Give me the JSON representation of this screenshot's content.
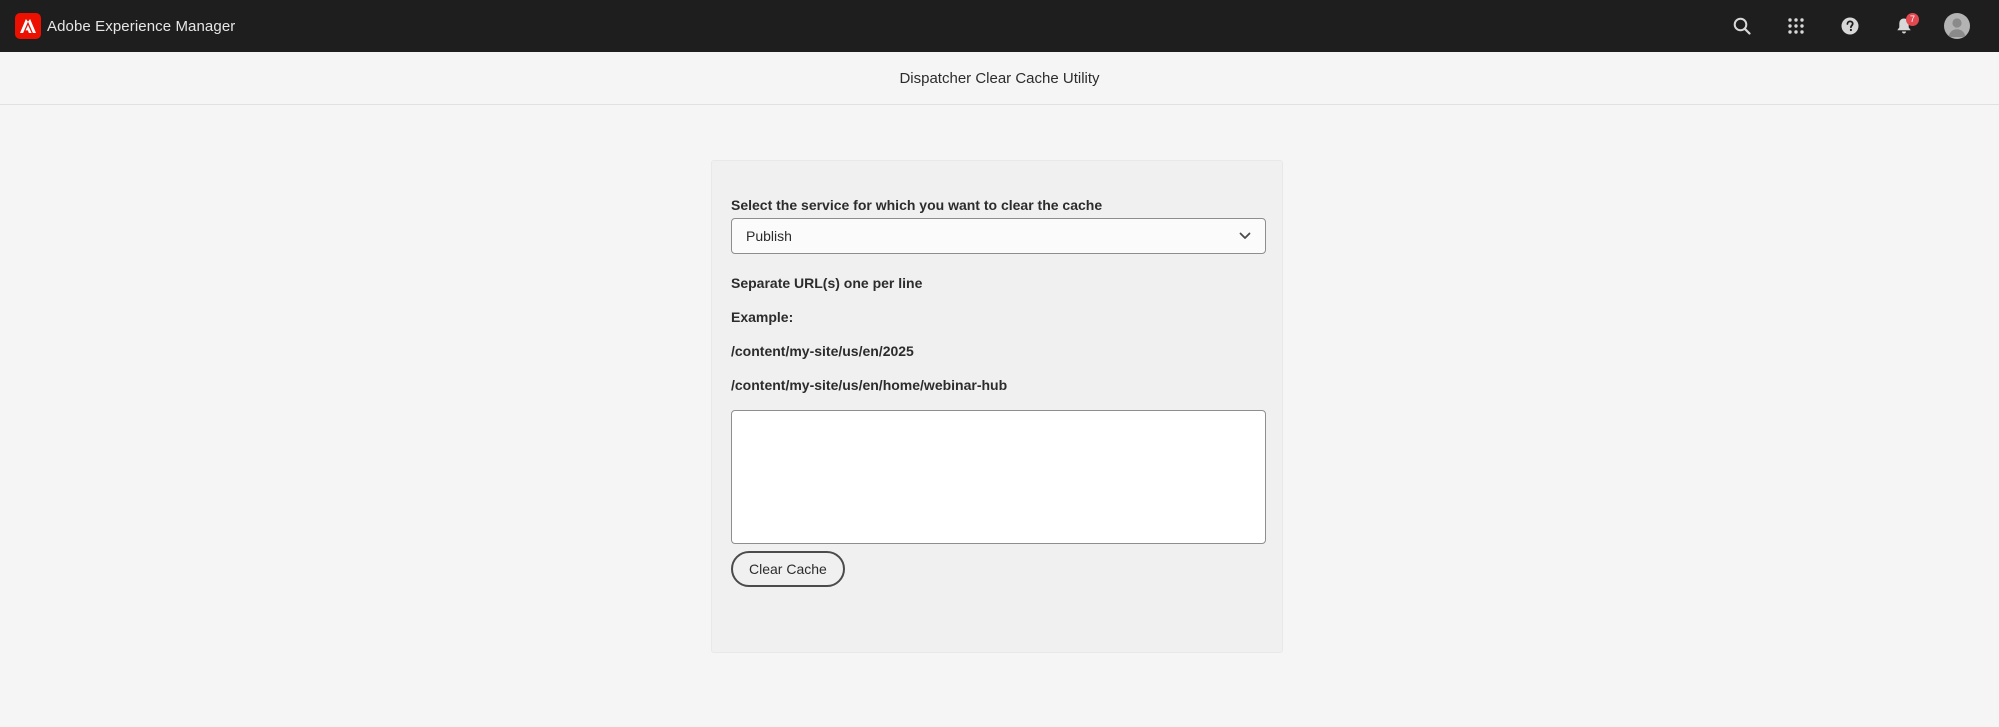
{
  "header": {
    "brand_title": "Adobe Experience Manager",
    "brand_icon": "adobe-logo-icon",
    "actions": [
      {
        "name": "search-icon"
      },
      {
        "name": "apps-grid-icon"
      },
      {
        "name": "help-icon"
      },
      {
        "name": "notifications-bell-icon",
        "badge": "7"
      },
      {
        "name": "user-avatar-icon"
      }
    ],
    "background": "#1e1e1e",
    "badge_color": "#e34850",
    "brand_color": "#eb1000"
  },
  "title_bar": {
    "title": "Dispatcher Clear Cache Utility"
  },
  "form": {
    "service_label": "Select the service for which you want to clear the cache",
    "service_selected": "Publish",
    "instructions": "Separate URL(s) one per line",
    "example_label": "Example:",
    "examples": [
      "/content/my-site/us/en/2025",
      "/content/my-site/us/en/home/webinar-hub"
    ],
    "urls_value": "",
    "submit_label": "Clear Cache"
  }
}
